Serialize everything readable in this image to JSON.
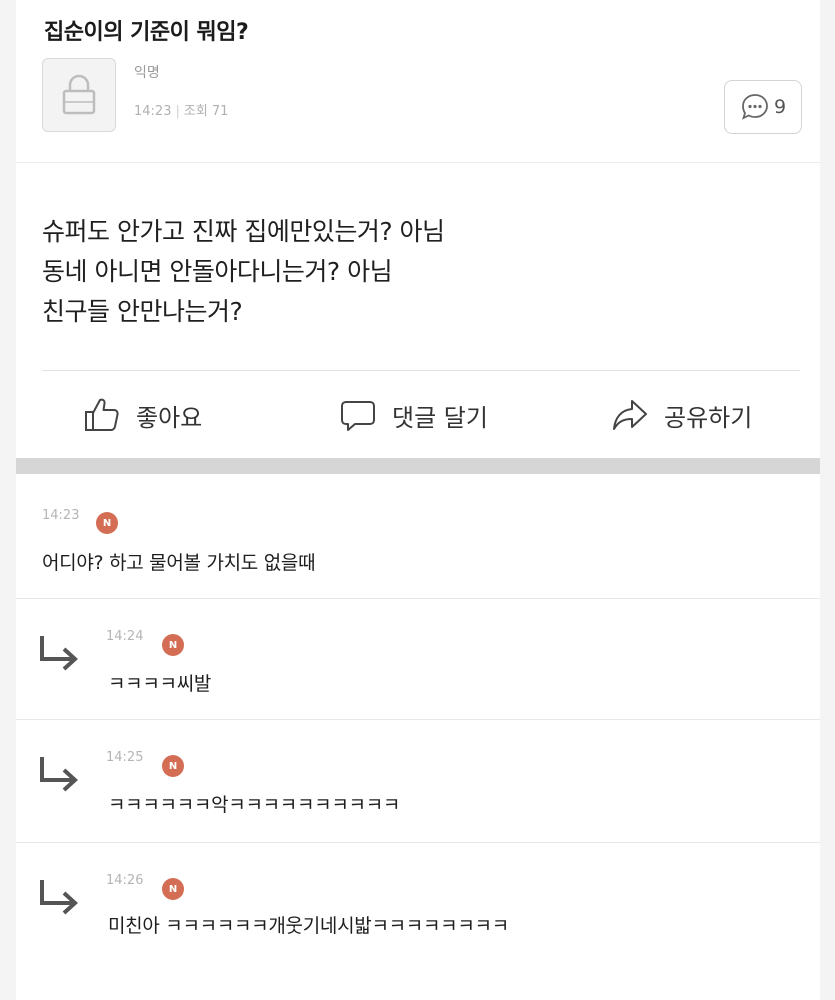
{
  "post": {
    "title": "집순이의 기준이 뭐임?",
    "author": "익명",
    "time": "14:23",
    "views": "조회 71",
    "comment_count": "9",
    "body_lines": [
      "슈퍼도 안가고 진짜 집에만있는거? 아님",
      "동네 아니면 안돌아다니는거? 아님",
      "친구들 안만나는거?"
    ]
  },
  "actions": {
    "like": "좋아요",
    "comment": "댓글 달기",
    "share": "공유하기"
  },
  "comments": [
    {
      "time": "14:23",
      "badge": "N",
      "text": "어디야? 하고 물어볼 가치도 없을때"
    },
    {
      "time": "14:24",
      "badge": "N",
      "text": "ㅋㅋㅋㅋ씨발"
    },
    {
      "time": "14:25",
      "badge": "N",
      "text": "ㅋㅋㅋㅋㅋㅋ악ㅋㅋㅋㅋㅋㅋㅋㅋㅋㅋ"
    },
    {
      "time": "14:26",
      "badge": "N",
      "text": "미친아 ㅋㅋㅋㅋㅋㅋ개웃기네시밟ㅋㅋㅋㅋㅋㅋㅋㅋ"
    }
  ]
}
